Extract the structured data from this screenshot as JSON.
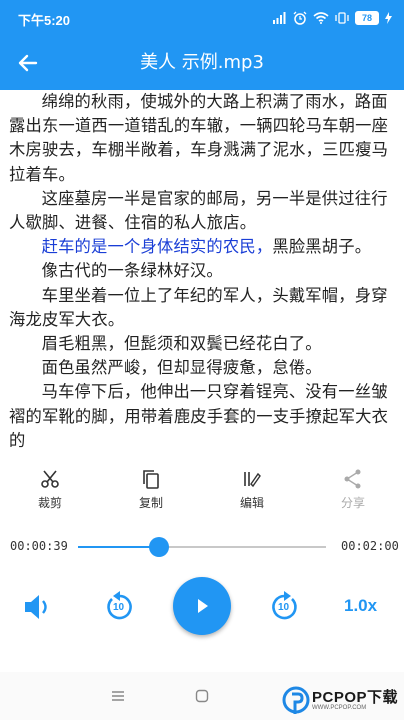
{
  "status_bar": {
    "time": "下午5:20",
    "battery": "78"
  },
  "app_bar": {
    "title": "美人 示例.mp3"
  },
  "content": {
    "paragraphs": [
      "绵绵的秋雨，使城外的大路上积满了雨水，路面露出东一道西一道错乱的车辙，一辆四轮马车朝一座木房驶去，车棚半敞着，车身溅满了泥水，三匹瘦马拉着车。",
      "这座墓房一半是官家的邮局，另一半是供过往行人歇脚、进餐、住宿的私人旅店。",
      "像古代的一条绿林好汉。",
      "车里坐着一位上了年纪的军人，头戴军帽，身穿海龙皮军大衣。",
      "眉毛粗黑，但髭须和双鬓已经花白了。",
      "面色虽然严峻，但却显得疲惫，怠倦。",
      "马车停下后，他伸出一只穿着锃亮、没有一丝皱褶的军靴的脚，用带着鹿皮手套的一支手撩起军大衣的"
    ],
    "highlight": "赶车的是一个身体结实的农民，",
    "highlight_rest": "黑脸黑胡子。"
  },
  "toolbar": {
    "cut_label": "裁剪",
    "copy_label": "复制",
    "edit_label": "编辑",
    "share_label": "分享"
  },
  "player": {
    "current_time": "00:00:39",
    "total_time": "00:02:00",
    "progress_fraction": 0.325,
    "speed": "1.0x",
    "rewind_seconds": "10",
    "forward_seconds": "10"
  },
  "watermark": {
    "text": "PCPOP下载",
    "sub": "WWW.PCPOP.COM"
  },
  "colors": {
    "accent": "#2196f3",
    "highlight_text": "#1a3ed6"
  }
}
